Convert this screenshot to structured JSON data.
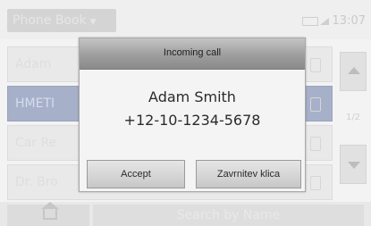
{
  "app": {
    "title": "Phone Book",
    "time": "13:07"
  },
  "contacts": [
    {
      "name": "Adam",
      "selected": false
    },
    {
      "name": "HMETI",
      "selected": true
    },
    {
      "name": "Car Re",
      "selected": false
    },
    {
      "name": "Dr. Bro",
      "selected": false
    }
  ],
  "scroll": {
    "page_indicator": "1/2"
  },
  "bottom": {
    "search_label": "Search by Name"
  },
  "dialog": {
    "title": "Incoming call",
    "caller_name": "Adam Smith",
    "caller_number": "+12-10-1234-5678",
    "accept_label": "Accept",
    "reject_label": "Zavrnitev klica"
  },
  "colors": {
    "selected_row": "#a6b0c9",
    "dialog_header": "#9e9e9e"
  }
}
